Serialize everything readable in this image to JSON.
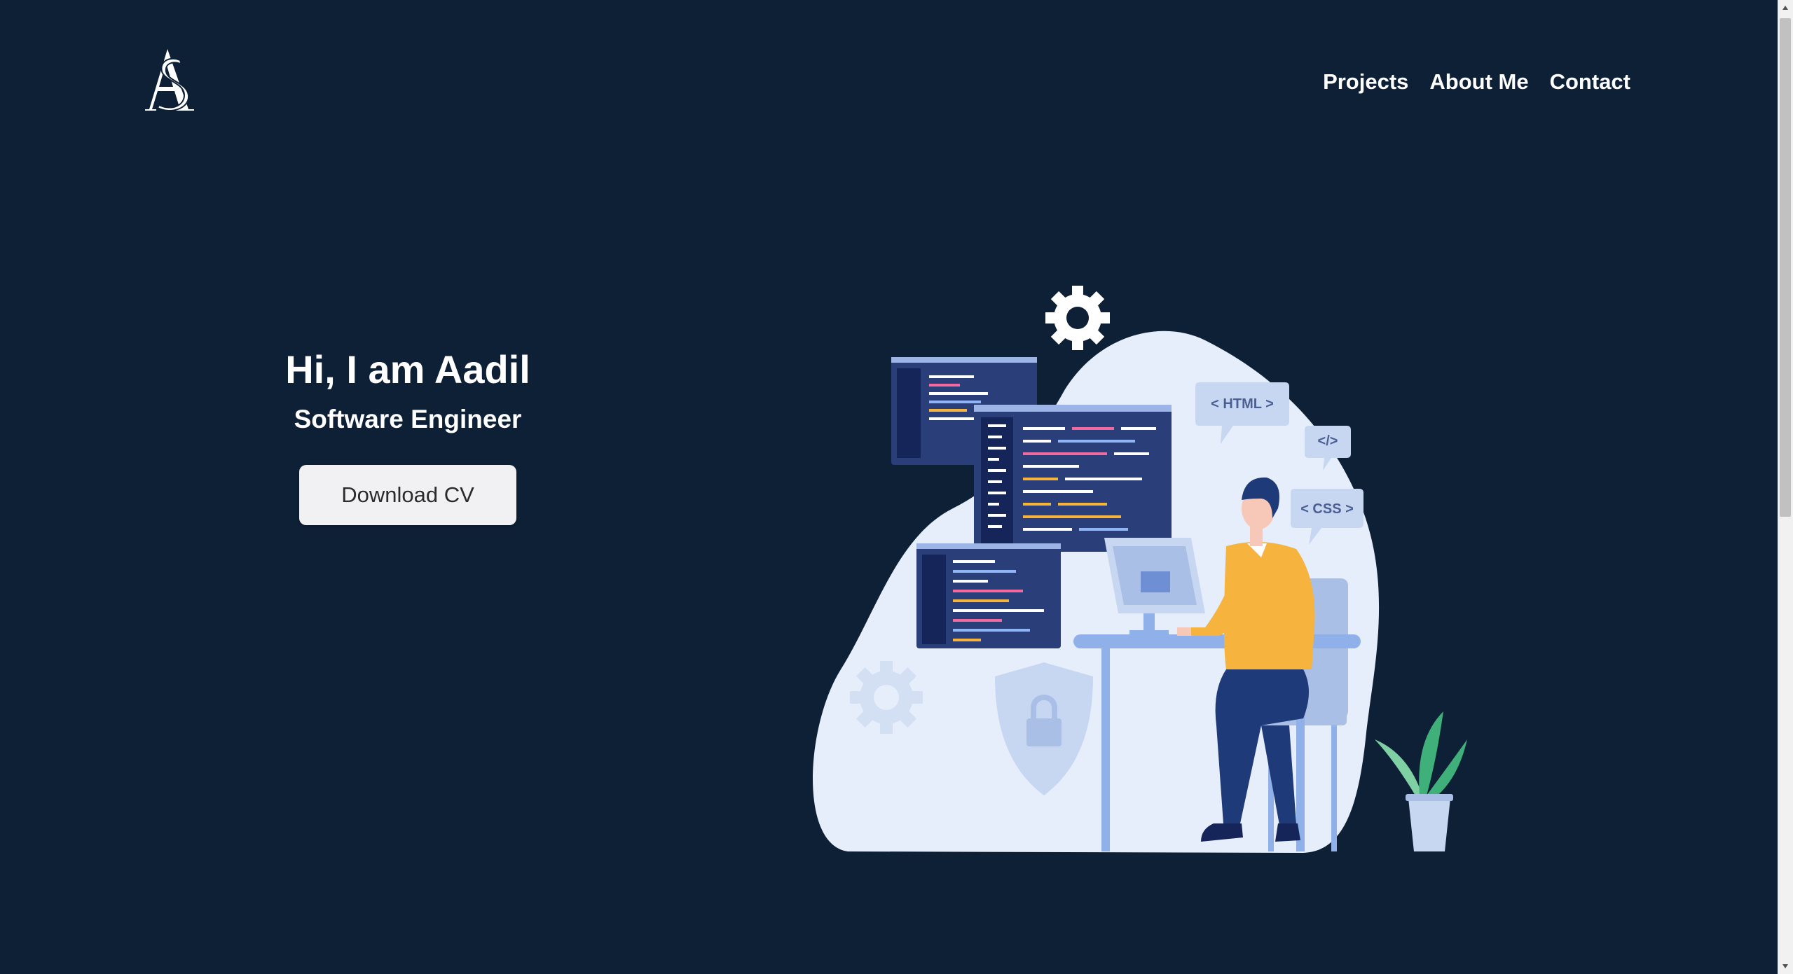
{
  "header": {
    "logo_icon": "as-monogram-logo",
    "nav": [
      "Projects",
      "About Me",
      "Contact"
    ]
  },
  "hero": {
    "greeting": "Hi, I am Aadil",
    "role": "Software Engineer",
    "cta_label": "Download CV"
  },
  "illustration": {
    "html_tag": "< HTML >",
    "code_tag": "</>",
    "css_tag": "< CSS >"
  },
  "colors": {
    "background": "#0e2036",
    "blob": "#e6eefb",
    "screen": "#2a3f7a",
    "shirt": "#f6b33e",
    "pants": "#1f3a78"
  }
}
